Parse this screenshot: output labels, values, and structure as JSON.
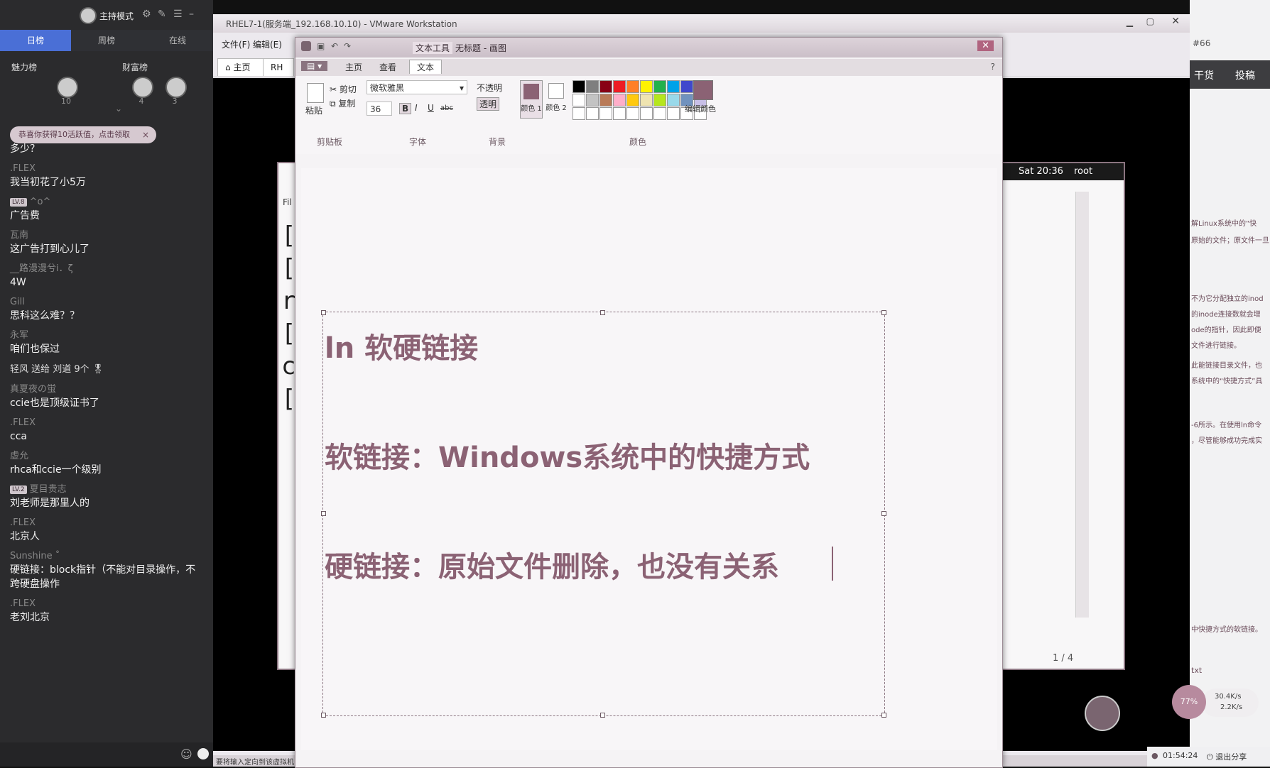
{
  "stream": {
    "mode_label": "主持模式",
    "tabs": [
      "日榜",
      "周榜",
      "在线"
    ],
    "rank_left_title": "魅力榜",
    "rank_right_title": "财富榜",
    "rank_values": [
      "10",
      "4",
      "3"
    ],
    "notice": "恭喜你获得10活跃值，点击领取",
    "notice_close": "×",
    "messages": [
      {
        "user": "",
        "text": "多少？"
      },
      {
        "user": ".FLEX",
        "text": "我当初花了小5万"
      },
      {
        "user": "^o^",
        "level": "LV.8",
        "text": "广告费"
      },
      {
        "user": "瓦南",
        "text": "这广告打到心儿了"
      },
      {
        "user": "__路漫漫兮i．ζ",
        "text": "4W"
      },
      {
        "user": "Gill",
        "text": "思科这么难？？"
      },
      {
        "user": "永军",
        "text": "咱们也保过"
      },
      {
        "user": "轻风 送给 刘道 9个",
        "text": ""
      },
      {
        "user": "真夏夜の蛍",
        "text": "ccie也是顶级证书了"
      },
      {
        "user": ".FLEX",
        "text": "cca"
      },
      {
        "user": "虚允",
        "text": "rhca和ccie一个级别"
      },
      {
        "user": "夏目贵志",
        "level": "LV.2",
        "text": "刘老师是那里人的"
      },
      {
        "user": ".FLEX",
        "text": "北京人"
      },
      {
        "user": "Sunshine ˚",
        "text": "硬链接：block指针（不能对目录操作，不"
      },
      {
        "user": "",
        "text": "跨硬盘操作"
      },
      {
        "user": ".FLEX",
        "text": "老刘北京"
      }
    ]
  },
  "vmware": {
    "title": "RHEL7-1(服务端_192.168.10.10) - VMware Workstation",
    "menu": [
      "文件(F)",
      "编辑(E)"
    ],
    "tabs": [
      "主页",
      "RH"
    ],
    "status_text": "要将输入定向到该虚拟机",
    "rhel_clock": "Sat 20:36",
    "rhel_user": "root",
    "rhel_file_label": "Fil",
    "rhel_page": "1 / 4"
  },
  "paint": {
    "title_tools": "文本工具",
    "title_doc": "无标题 - 画图",
    "ribbon_tabs": [
      "主页",
      "查看",
      "文本"
    ],
    "clipboard": {
      "paste": "粘贴",
      "cut": "剪切",
      "copy": "复制",
      "group": "剪贴板"
    },
    "font": {
      "family": "微软雅黑",
      "size": "36",
      "bold": "B",
      "italic": "I",
      "underline": "U",
      "strike": "abc",
      "group": "字体"
    },
    "background": {
      "opaque": "不透明",
      "transparent": "透明",
      "group": "背景"
    },
    "colors": {
      "color1": "颜色 1",
      "color2": "颜色 2",
      "edit": "编辑颜色",
      "group": "颜色"
    },
    "canvas_lines": [
      "ln  软硬链接",
      "软链接：Windows系统中的快捷方式",
      "硬链接：原始文件删除，也没有关系"
    ]
  },
  "right": {
    "nav": [
      "干货",
      "投稿"
    ],
    "top_label": "#66",
    "snippets": [
      "解Linux系统中的“快",
      "原始的文件；原文件一旦",
      "不为它分配独立的inod",
      "的inode连接数就会增",
      "ode的指针，因此即便",
      "文件进行链接。",
      "此能链接目录文件，也",
      "系统中的“快捷方式”具",
      "-6所示。在使用ln命令",
      "，尽管能够成功完成实",
      "中快捷方式的软链接。",
      "txt"
    ],
    "speed_percent": "77%",
    "speed_up": "30.4K/s",
    "speed_down": "2.2K/s",
    "timer": "01:54:24",
    "exit_share": "退出分享"
  },
  "colors": {
    "accent": "#8b6274",
    "palette": [
      "#000000",
      "#7f7f7f",
      "#880015",
      "#ed1c24",
      "#ff7f27",
      "#fff200",
      "#22b14c",
      "#00a2e8",
      "#3f48cc",
      "#a349a4",
      "#ffffff",
      "#c3c3c3",
      "#b97a57",
      "#ffaec9",
      "#ffc90e",
      "#efe4b0",
      "#b5e61d",
      "#99d9ea",
      "#7092be",
      "#c8bfe7"
    ]
  }
}
